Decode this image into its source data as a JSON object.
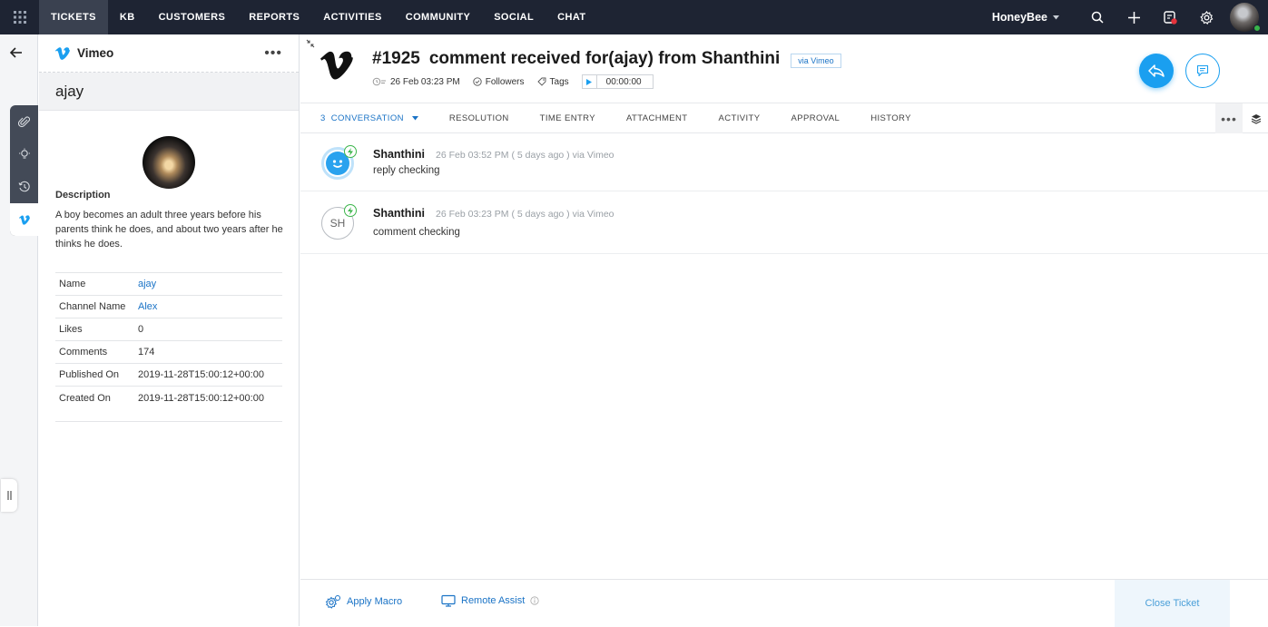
{
  "nav": {
    "items": [
      {
        "label": "TICKETS",
        "active": true
      },
      {
        "label": "KB"
      },
      {
        "label": "CUSTOMERS"
      },
      {
        "label": "REPORTS"
      },
      {
        "label": "ACTIVITIES"
      },
      {
        "label": "COMMUNITY"
      },
      {
        "label": "SOCIAL"
      },
      {
        "label": "CHAT"
      }
    ],
    "department": "HoneyBee",
    "icons": [
      "apps-grid-icon",
      "search-icon",
      "plus-icon",
      "notifications-icon",
      "gear-icon"
    ]
  },
  "side_panel": {
    "title": "Vimeo",
    "name": "ajay",
    "description_label": "Description",
    "description": "A boy becomes an adult three years before his parents think he does, and about two years after he thinks he does.",
    "properties": [
      {
        "key": "Name",
        "value": "ajay",
        "link": true
      },
      {
        "key": "Channel Name",
        "value": "Alex",
        "link": true
      },
      {
        "key": "Likes",
        "value": "0"
      },
      {
        "key": "Comments",
        "value": "174"
      },
      {
        "key": "Published On",
        "value": "2019-11-28T15:00:12+00:00"
      },
      {
        "key": "Created On",
        "value": "2019-11-28T15:00:12+00:00"
      }
    ]
  },
  "ticket": {
    "id": "#1925",
    "subject": "comment received for(ajay) from Shanthini",
    "via": "via Vimeo",
    "created": "26 Feb 03:23 PM",
    "followers_label": "Followers",
    "tags_label": "Tags",
    "timer": "00:00:00"
  },
  "tabs": {
    "conversation": "3  CONVERSATION",
    "items": [
      "RESOLUTION",
      "TIME ENTRY",
      "ATTACHMENT",
      "ACTIVITY",
      "APPROVAL",
      "HISTORY"
    ]
  },
  "threads": [
    {
      "author": "Shanthini",
      "time": "26 Feb 03:52 PM ( 5 days ago ) via Vimeo",
      "body": "reply checking",
      "avatar": "bot"
    },
    {
      "author": "Shanthini",
      "time": "26 Feb 03:23 PM ( 5 days ago ) via Vimeo",
      "body": "comment checking",
      "avatar": "SH"
    }
  ],
  "footer": {
    "apply_macro": "Apply Macro",
    "remote_assist": "Remote Assist",
    "close_ticket": "Close Ticket"
  },
  "colors": {
    "nav_bg": "#1e2433",
    "accent": "#1a9ff0",
    "link": "#1a73c6"
  }
}
